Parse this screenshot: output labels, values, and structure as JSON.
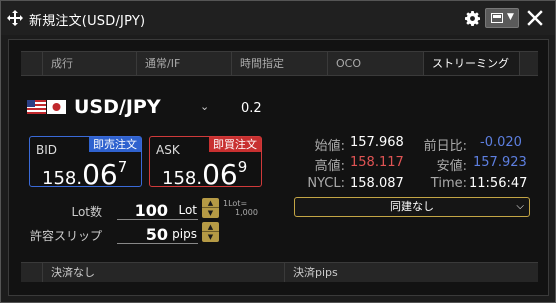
{
  "window": {
    "title": "新規注文(USD/JPY)",
    "icons": [
      "move-icon",
      "gear-icon",
      "window-menu-icon",
      "close-icon"
    ]
  },
  "tabs": [
    {
      "label": ""
    },
    {
      "label": "成行"
    },
    {
      "label": "通常/IF"
    },
    {
      "label": "時間指定"
    },
    {
      "label": "OCO"
    },
    {
      "label": "ストリーミング",
      "active": true
    },
    {
      "label": ""
    }
  ],
  "instrument": {
    "pair": "USD/JPY",
    "spread": "0.2",
    "flag_icons": [
      "us-flag-icon",
      "jp-flag-icon"
    ]
  },
  "bid": {
    "label": "BID",
    "button": "即売注文",
    "price_prefix": "158.",
    "price_big": "06",
    "price_last": "7"
  },
  "ask": {
    "label": "ASK",
    "button": "即買注文",
    "price_prefix": "158.",
    "price_big": "06",
    "price_last": "9"
  },
  "stats": {
    "open_label": "始値:",
    "open": "157.968",
    "prev_change_label": "前日比:",
    "prev_change": "-0.020",
    "high_label": "高値:",
    "high": "158.117",
    "low_label": "安値:",
    "low": "157.923",
    "nycl_label": "NYCL:",
    "nycl": "158.087",
    "time_label": "Time:",
    "time": "11:56:47"
  },
  "order": {
    "lot_label": "Lot数",
    "lot_value": "100",
    "lot_unit": "Lot",
    "lot_note_1": "1Lot=",
    "lot_note_2": "1,000",
    "slip_label": "許容スリップ",
    "slip_value": "50",
    "slip_unit": "pips",
    "link_select": "同建なし"
  },
  "settlement": [
    {
      "label": ""
    },
    {
      "label": "決済なし"
    },
    {
      "label": "決済pips"
    }
  ],
  "colors": {
    "bid_accent": "#2f62cf",
    "ask_accent": "#c83030",
    "high_value": "#e05454",
    "negative_value": "#5d7fe0",
    "stepper": "#b59a45"
  }
}
